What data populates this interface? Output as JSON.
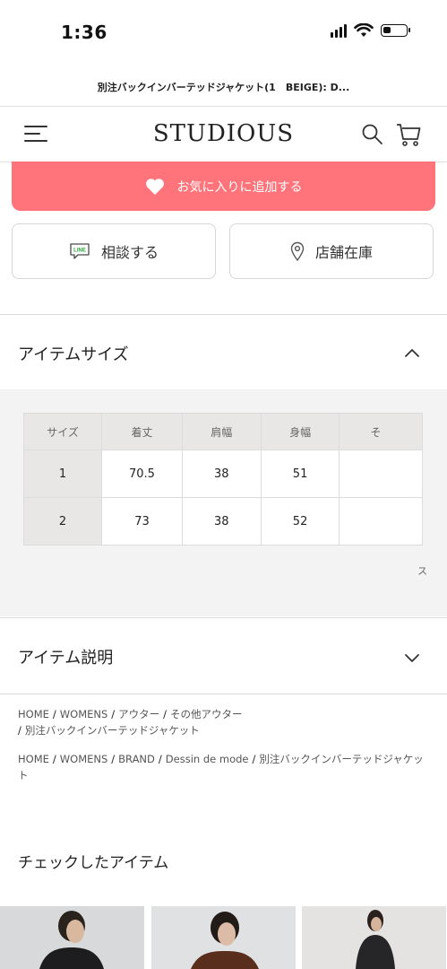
{
  "status_bar": {
    "time": "1:36"
  },
  "browser": {
    "page_title": "別注バックインバーテッドジャケット(1　BEIGE): D..."
  },
  "header": {
    "brand": "STUDIOUS"
  },
  "actions": {
    "favorite_label": "お気に入りに追加する",
    "consult_label": "相談する",
    "line_badge": "LINE",
    "store_stock_label": "店舗在庫"
  },
  "size_section": {
    "title": "アイテムサイズ",
    "columns": [
      "サイズ",
      "着丈",
      "肩幅",
      "身幅",
      "そ"
    ],
    "rows": [
      [
        "1",
        "70.5",
        "38",
        "51",
        ""
      ],
      [
        "2",
        "73",
        "38",
        "52",
        ""
      ]
    ],
    "scroll_hint": "ス"
  },
  "description_section": {
    "title": "アイテム説明"
  },
  "breadcrumbs": {
    "trail1": [
      "HOME",
      "WOMENS",
      "アウター",
      "その他アウター"
    ],
    "trail1_last": "別注バックインバーテッドジャケット",
    "trail2": [
      "HOME",
      "WOMENS",
      "BRAND",
      "Dessin de mode",
      "別注バックインバーテッドジャケット"
    ]
  },
  "checked_items": {
    "title": "チェックしたアイテム"
  },
  "colors": {
    "favorite": "#ff737a",
    "table_header": "#e9e7e5",
    "grey_area": "#f4f3f3"
  }
}
